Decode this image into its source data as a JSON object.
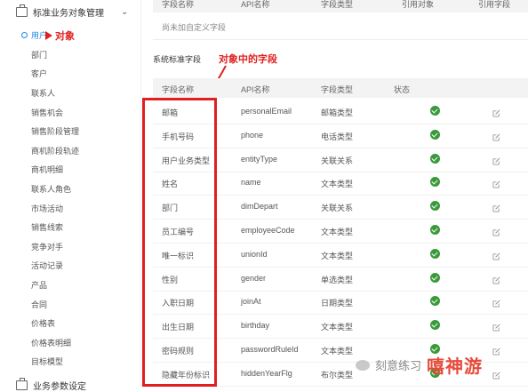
{
  "sidebar": {
    "section1": "标准业务对象管理",
    "items": [
      "用户",
      "部门",
      "客户",
      "联系人",
      "销售机会",
      "销售阶段管理",
      "商机阶段轨迹",
      "商机明细",
      "联系人角色",
      "市场活动",
      "销售线索",
      "竞争对手",
      "活动记录",
      "产品",
      "合同",
      "价格表",
      "价格表明细",
      "目标模型"
    ],
    "section2": "业务参数设定"
  },
  "annotations": {
    "user_object": "对象",
    "fields": "对象中的字段"
  },
  "top_table": {
    "headers": [
      "字段名称",
      "API名称",
      "字段类型",
      "引用对象",
      "引用字段"
    ],
    "empty_text": "尚未加自定义字段"
  },
  "standard_section_title": "系统标准字段",
  "main_table": {
    "headers": [
      "字段名称",
      "API名称",
      "字段类型",
      "状态"
    ],
    "rows": [
      {
        "name": "邮箱",
        "api": "personalEmail",
        "type": "邮箱类型"
      },
      {
        "name": "手机号码",
        "api": "phone",
        "type": "电话类型"
      },
      {
        "name": "用户业务类型",
        "api": "entityType",
        "type": "关联关系"
      },
      {
        "name": "姓名",
        "api": "name",
        "type": "文本类型"
      },
      {
        "name": "部门",
        "api": "dimDepart",
        "type": "关联关系"
      },
      {
        "name": "员工编号",
        "api": "employeeCode",
        "type": "文本类型"
      },
      {
        "name": "唯一标识",
        "api": "unionId",
        "type": "文本类型"
      },
      {
        "name": "性别",
        "api": "gender",
        "type": "单选类型"
      },
      {
        "name": "入职日期",
        "api": "joinAt",
        "type": "日期类型"
      },
      {
        "name": "出生日期",
        "api": "birthday",
        "type": "文本类型"
      },
      {
        "name": "密码规则",
        "api": "passwordRuleId",
        "type": "文本类型"
      },
      {
        "name": "隐藏年份标识",
        "api": "hiddenYearFlg",
        "type": "布尔类型"
      }
    ]
  },
  "watermark": {
    "brand": "刻意练习",
    "site": "嘻神游"
  },
  "colors": {
    "accent": "#1e88e5",
    "annotation": "#e02020",
    "status_ok": "#3a9a3a"
  }
}
